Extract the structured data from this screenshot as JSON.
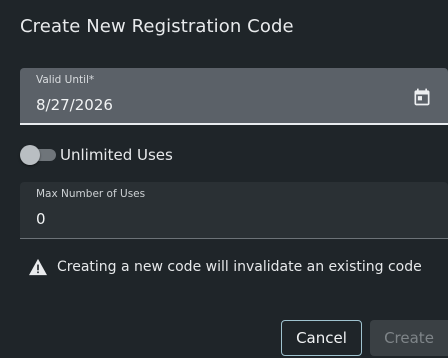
{
  "dialog": {
    "title": "Create New Registration Code"
  },
  "valid_until": {
    "label": "Valid Until*",
    "value": "8/27/2026",
    "icon": "calendar-icon"
  },
  "unlimited_uses": {
    "label": "Unlimited Uses",
    "checked": false
  },
  "max_uses": {
    "label": "Max Number of Uses",
    "value": "0"
  },
  "warning": {
    "icon": "warning-icon",
    "text": "Creating a new code will invalidate an existing code"
  },
  "actions": {
    "cancel_label": "Cancel",
    "create_label": "Create",
    "create_enabled": false
  },
  "colors": {
    "background": "#1f2529",
    "date_field_bg": "#5b6168",
    "input_bg": "#2a3034",
    "cancel_border": "#9fc3cf",
    "disabled_button_bg": "#3a4044"
  }
}
